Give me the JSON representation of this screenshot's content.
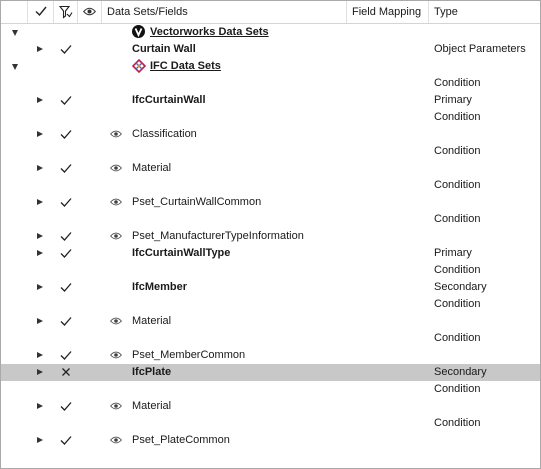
{
  "header": {
    "columns": [
      {
        "name": "expand",
        "label": ""
      },
      {
        "name": "include",
        "icon": "check-icon"
      },
      {
        "name": "mapping-state",
        "icon": "filter-icon"
      },
      {
        "name": "visibility",
        "icon": "eye-icon"
      },
      {
        "name": "datasets",
        "label": "Data Sets/Fields"
      },
      {
        "name": "field-mapping",
        "label": "Field Mapping"
      },
      {
        "name": "type",
        "label": "Type"
      }
    ]
  },
  "rows": [
    {
      "name": "Vectorworks Data Sets",
      "type": "",
      "expand": "down",
      "check": "",
      "eye": false,
      "style": "group-vw"
    },
    {
      "name": "Curtain Wall",
      "type": "Object Parameters",
      "expand": "right",
      "check": "check",
      "eye": false,
      "style": "bold"
    },
    {
      "name": "IFC Data Sets",
      "type": "",
      "expand": "down",
      "check": "",
      "eye": false,
      "style": "group-ifc"
    },
    {
      "name": "",
      "type": "Condition",
      "expand": "",
      "check": "",
      "eye": false,
      "style": ""
    },
    {
      "name": "IfcCurtainWall",
      "type": "Primary",
      "expand": "right",
      "check": "check",
      "eye": false,
      "style": "bold"
    },
    {
      "name": "",
      "type": "Condition",
      "expand": "",
      "check": "",
      "eye": false,
      "style": ""
    },
    {
      "name": "Classification",
      "type": "",
      "expand": "right",
      "check": "check",
      "eye": true,
      "style": ""
    },
    {
      "name": "",
      "type": "Condition",
      "expand": "",
      "check": "",
      "eye": false,
      "style": ""
    },
    {
      "name": "Material",
      "type": "",
      "expand": "right",
      "check": "check",
      "eye": true,
      "style": ""
    },
    {
      "name": "",
      "type": "Condition",
      "expand": "",
      "check": "",
      "eye": false,
      "style": ""
    },
    {
      "name": "Pset_CurtainWallCommon",
      "type": "",
      "expand": "right",
      "check": "check",
      "eye": true,
      "style": ""
    },
    {
      "name": "",
      "type": "Condition",
      "expand": "",
      "check": "",
      "eye": false,
      "style": ""
    },
    {
      "name": "Pset_ManufacturerTypeInformation",
      "type": "",
      "expand": "right",
      "check": "check",
      "eye": true,
      "style": ""
    },
    {
      "name": "IfcCurtainWallType",
      "type": "Primary",
      "expand": "right",
      "check": "check",
      "eye": false,
      "style": "bold"
    },
    {
      "name": "",
      "type": "Condition",
      "expand": "",
      "check": "",
      "eye": false,
      "style": ""
    },
    {
      "name": "IfcMember",
      "type": "Secondary",
      "expand": "right",
      "check": "check",
      "eye": false,
      "style": "bold"
    },
    {
      "name": "",
      "type": "Condition",
      "expand": "",
      "check": "",
      "eye": false,
      "style": ""
    },
    {
      "name": "Material",
      "type": "",
      "expand": "right",
      "check": "check",
      "eye": true,
      "style": ""
    },
    {
      "name": "",
      "type": "Condition",
      "expand": "",
      "check": "",
      "eye": false,
      "style": ""
    },
    {
      "name": "Pset_MemberCommon",
      "type": "",
      "expand": "right",
      "check": "check",
      "eye": true,
      "style": ""
    },
    {
      "name": "IfcPlate",
      "type": "Secondary",
      "expand": "right",
      "check": "cross",
      "eye": false,
      "style": "bold",
      "selected": true
    },
    {
      "name": "",
      "type": "Condition",
      "expand": "",
      "check": "",
      "eye": false,
      "style": ""
    },
    {
      "name": "Material",
      "type": "",
      "expand": "right",
      "check": "check",
      "eye": true,
      "style": ""
    },
    {
      "name": "",
      "type": "Condition",
      "expand": "",
      "check": "",
      "eye": false,
      "style": ""
    },
    {
      "name": "Pset_PlateCommon",
      "type": "",
      "expand": "right",
      "check": "check",
      "eye": true,
      "style": ""
    }
  ],
  "colors": {
    "selected_row": "#c8c8c8",
    "ifc_logo": "#c2185b"
  }
}
